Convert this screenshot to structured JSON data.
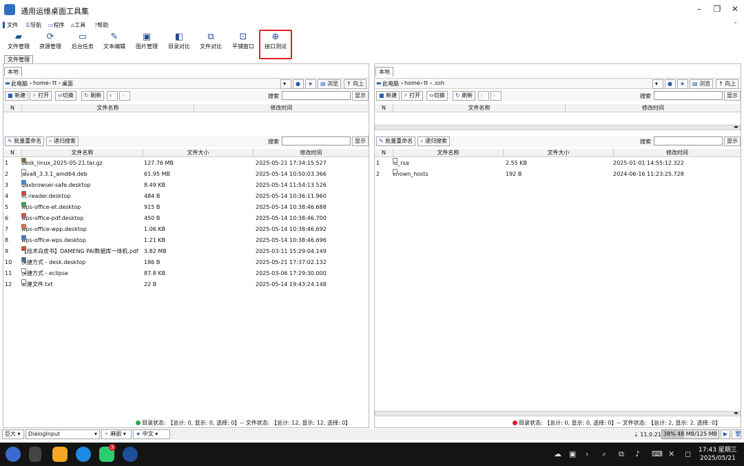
{
  "app": {
    "title": "通用运维桌面工具集"
  },
  "menu": [
    {
      "icon": "file-icon",
      "label": "文件"
    },
    {
      "icon": "menu-icon",
      "label": "导航"
    },
    {
      "icon": "program-icon",
      "label": "程序"
    },
    {
      "icon": "tools-icon",
      "label": "工具"
    },
    {
      "icon": "help-icon",
      "label": "帮助"
    }
  ],
  "toolbar": [
    {
      "icon": "folder-icon",
      "glyph": "▰",
      "label": "文件管理"
    },
    {
      "icon": "resource-icon",
      "glyph": "⟳",
      "label": "资源管理"
    },
    {
      "icon": "monitor-icon",
      "glyph": "▭",
      "label": "后台任务"
    },
    {
      "icon": "edit-icon",
      "glyph": "✎",
      "label": "文本编辑"
    },
    {
      "icon": "image-icon",
      "glyph": "▣",
      "label": "图片管理"
    },
    {
      "icon": "dir-compare-icon",
      "glyph": "◧",
      "label": "目录对比"
    },
    {
      "icon": "file-compare-icon",
      "glyph": "⧉",
      "label": "文件对比"
    },
    {
      "icon": "window-icon",
      "glyph": "⊡",
      "label": "平铺窗口"
    },
    {
      "icon": "api-test-icon",
      "glyph": "⊕",
      "label": "接口测试"
    }
  ],
  "main_tab": "文件管理",
  "left": {
    "tab": "本地",
    "path": [
      "此电脑",
      "home",
      "tt",
      "桌面"
    ],
    "browse": "浏览",
    "up": "向上",
    "actions": {
      "new": "新建",
      "open": "打开",
      "switch": "切换",
      "refresh": "刷新",
      "search_label": "搜索",
      "show": "显示"
    },
    "top_headers": [
      "N",
      "文件名称",
      "修改时间"
    ],
    "bottom_actions": {
      "rename": "批量重命名",
      "recursive": "递归搜索",
      "search_label": "搜索",
      "show": "显示"
    },
    "headers": [
      "N",
      "文件名称",
      "文件大小",
      "修改时间"
    ],
    "files": [
      {
        "n": "1",
        "name": "desk_linux_2025-05-21.tar.gz",
        "size": "127.76 MB",
        "time": "2025-05-21 17:34:15.527",
        "color": "#8a6d3b"
      },
      {
        "n": "2",
        "name": "java8_3.3.1_amd64.deb",
        "size": "61.95 MB",
        "time": "2025-05-14 10:50:03.366",
        "color": "#ffffff"
      },
      {
        "n": "3",
        "name": "qaxbrowser-safe.desktop",
        "size": "8.49 KB",
        "time": "2025-05-14 11:54:13.526",
        "color": "#3a8ee6"
      },
      {
        "n": "4",
        "name": "sc-reader.desktop",
        "size": "484 B",
        "time": "2025-05-14 10:36:11.960",
        "color": "#e04040"
      },
      {
        "n": "5",
        "name": "wps-office-et.desktop",
        "size": "915 B",
        "time": "2025-05-14 10:38:46.688",
        "color": "#2ea84f"
      },
      {
        "n": "6",
        "name": "wps-office-pdf.desktop",
        "size": "450 B",
        "time": "2025-05-14 10:38:46.700",
        "color": "#e05050"
      },
      {
        "n": "7",
        "name": "wps-office-wpp.desktop",
        "size": "1.06 KB",
        "time": "2025-05-14 10:38:46.692",
        "color": "#f07030"
      },
      {
        "n": "8",
        "name": "wps-office-wps.desktop",
        "size": "1.21 KB",
        "time": "2025-05-14 10:38:46.696",
        "color": "#3a78e0"
      },
      {
        "n": "9",
        "name": "【技术白皮书】DAMENG PAI数据库一体机.pdf",
        "size": "3.82 MB",
        "time": "2025-03-11 15:29:04.149",
        "color": "#e04a2a"
      },
      {
        "n": "10",
        "name": "快捷方式 - desk.desktop",
        "size": "186 B",
        "time": "2025-05-21 17:37:02.132",
        "color": "#4a6fa5"
      },
      {
        "n": "11",
        "name": "快捷方式 - eclipse",
        "size": "87.8 KB",
        "time": "2025-03-06 17:29:30.000",
        "color": "#ffffff"
      },
      {
        "n": "12",
        "name": "新建文件.txt",
        "size": "22 B",
        "time": "2025-05-14 19:43:24.148",
        "color": "#ffffff"
      }
    ],
    "status": "目录状态: 【总计: 0, 显示: 0, 选择: 0】-- 文件状态: 【总计: 12, 显示: 12, 选择: 0】",
    "status_color": "#2ea84f"
  },
  "right": {
    "tab": "本地",
    "path": [
      "此电脑",
      "home",
      "tt",
      ".ssh"
    ],
    "browse": "浏览",
    "up": "向上",
    "actions": {
      "new": "新建",
      "open": "打开",
      "switch": "切换",
      "refresh": "刷新",
      "search_label": "搜索",
      "show": "显示"
    },
    "top_headers": [
      "N",
      "文件名称",
      "修改时间"
    ],
    "bottom_actions": {
      "rename": "批量重命名",
      "recursive": "递归搜索",
      "search_label": "搜索",
      "show": "显示"
    },
    "headers": [
      "N",
      "文件名称",
      "文件大小",
      "修改时间"
    ],
    "files": [
      {
        "n": "1",
        "name": "id_rsa",
        "size": "2.55 KB",
        "time": "2025-01-01 14:55:12.322",
        "color": "#ffffff"
      },
      {
        "n": "2",
        "name": "known_hosts",
        "size": "192 B",
        "time": "2024-06-16 11:23:25.728",
        "color": "#ffffff"
      }
    ],
    "status": "目录状态: 【总计: 0, 显示: 0, 选择: 0】-- 文件状态: 【总计: 2, 显示: 2, 选择: 0】",
    "status_color": "#e02020"
  },
  "bottombar": {
    "size": "巨大",
    "font": "DialogInput",
    "theme": "麻丽",
    "lang": "中文",
    "version": "11.0.21",
    "mem_pct": "38%",
    "mem": "48 MB/125 MB"
  },
  "taskbar": {
    "time": "17:43 星期三",
    "date": "2025/05/21",
    "badge": "3"
  }
}
